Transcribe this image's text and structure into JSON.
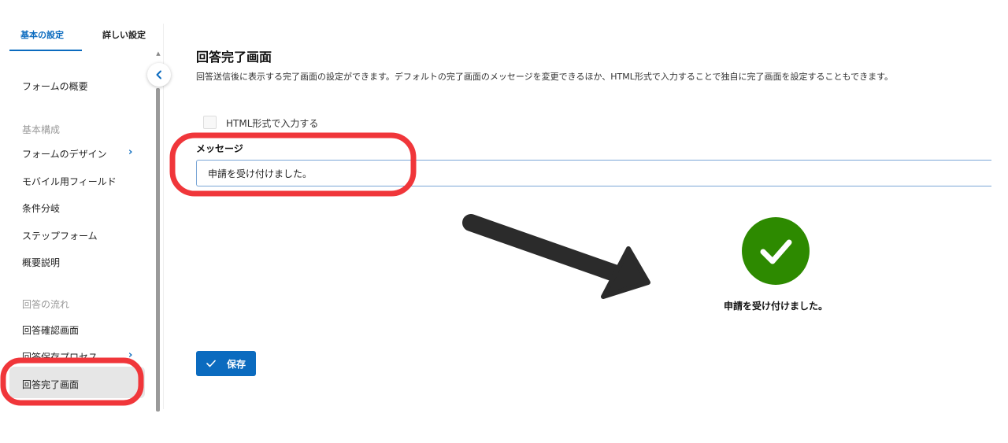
{
  "sidebar": {
    "tabs": [
      {
        "label": "基本の設定"
      },
      {
        "label": "詳しい設定"
      }
    ],
    "items": {
      "overview": "フォームの概要",
      "section_basic": "基本構成",
      "design": "フォームのデザイン",
      "mobile": "モバイル用フィールド",
      "branch": "条件分岐",
      "step": "ステップフォーム",
      "summary": "概要説明",
      "section_flow": "回答の流れ",
      "confirm": "回答確認画面",
      "save_process": "回答保存プロセス",
      "complete": "回答完了画面"
    }
  },
  "main": {
    "title": "回答完了画面",
    "description": "回答送信後に表示する完了画面の設定ができます。デフォルトの完了画面のメッセージを変更できるほか、HTML形式で入力することで独自に完了画面を設定することもできます。",
    "html_checkbox_label": "HTML形式で入力する",
    "message_label": "メッセージ",
    "message_value": "申請を受け付けました。",
    "preview_message": "申請を受け付けました。",
    "save_label": "保存"
  },
  "colors": {
    "accent": "#0b6bbf",
    "success": "#2d8a00",
    "annotation": "#f0363a"
  }
}
